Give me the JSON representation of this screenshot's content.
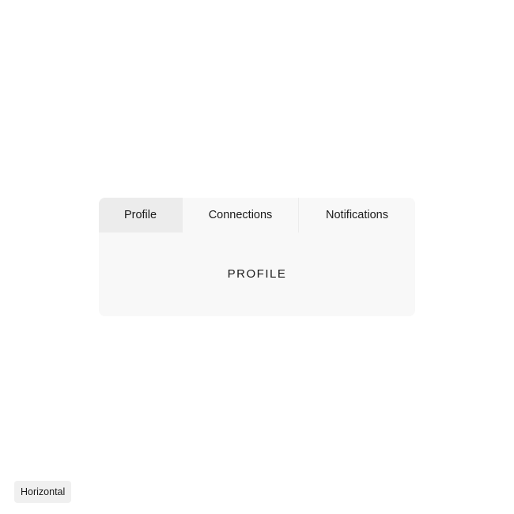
{
  "tabs": [
    {
      "label": "Profile",
      "selected": true
    },
    {
      "label": "Connections",
      "selected": false
    },
    {
      "label": "Notifications",
      "selected": false
    }
  ],
  "panel": {
    "content": "PROFILE"
  },
  "orientation_label": "Horizontal"
}
